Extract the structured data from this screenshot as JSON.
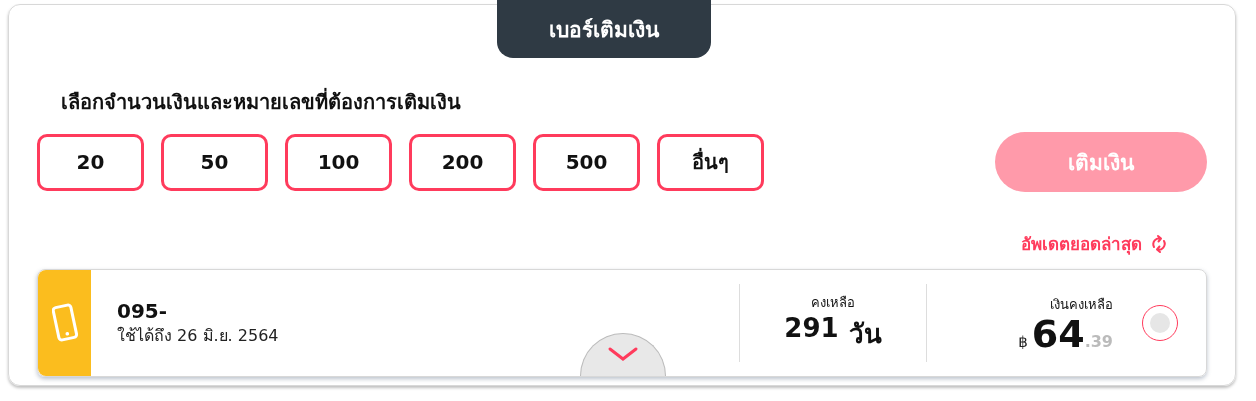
{
  "tab": {
    "label": "เบอร์เติมเงิน"
  },
  "heading": "เลือกจำนวนเงินและหมายเลขที่ต้องการเติมเงิน",
  "amounts": [
    {
      "label": "20",
      "selected": false
    },
    {
      "label": "50",
      "selected": false
    },
    {
      "label": "100",
      "selected": false
    },
    {
      "label": "200",
      "selected": false
    },
    {
      "label": "500",
      "selected": false
    },
    {
      "label": "อื่นๆ",
      "selected": false
    }
  ],
  "topup_button": {
    "label": "เติมเงิน",
    "disabled": true
  },
  "refresh_link": "อัพเดตยอดล่าสุด",
  "number_card": {
    "number": "095-",
    "expiry": "ใช้ได้ถึง 26 มิ.ย. 2564",
    "days_label": "คงเหลือ",
    "days_value": "291",
    "days_unit": "วัน",
    "balance_label": "เงินคงเหลือ",
    "currency": "฿",
    "balance_main": "64",
    "balance_decimal": ".39",
    "selected": false
  }
}
